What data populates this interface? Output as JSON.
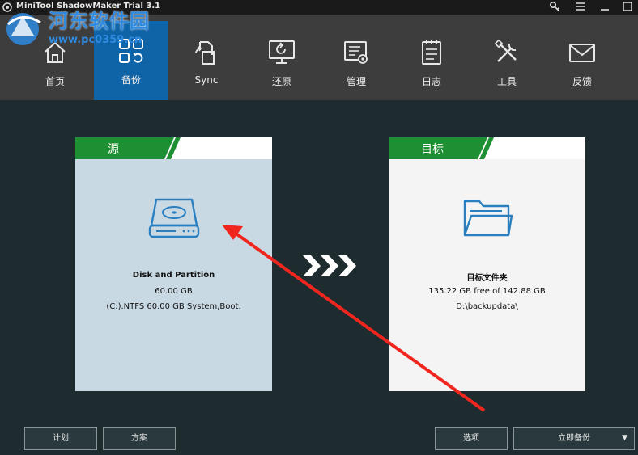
{
  "window": {
    "title": "MiniTool ShadowMaker Trial 3.1",
    "controls": [
      "key-icon",
      "menu-icon",
      "minimize-icon",
      "maximize-icon"
    ]
  },
  "watermark": {
    "main": "河东软件园",
    "url": "www.pc0359.cn"
  },
  "nav": {
    "items": [
      {
        "label": "首页",
        "icon": "home-icon"
      },
      {
        "label": "备份",
        "icon": "backup-icon",
        "active": true
      },
      {
        "label": "Sync",
        "icon": "sync-icon"
      },
      {
        "label": "还原",
        "icon": "restore-icon"
      },
      {
        "label": "管理",
        "icon": "manage-icon"
      },
      {
        "label": "日志",
        "icon": "log-icon"
      },
      {
        "label": "工具",
        "icon": "tools-icon"
      },
      {
        "label": "反馈",
        "icon": "feedback-icon"
      }
    ]
  },
  "source": {
    "tab_label": "源",
    "title": "Disk and Partition",
    "size": "60.00 GB",
    "detail": "(C:).NTFS 60.00 GB System,Boot."
  },
  "target": {
    "tab_label": "目标",
    "title": "目标文件夹",
    "free": "135.22 GB free of 142.88 GB",
    "path": "D:\\backupdata\\"
  },
  "buttons": {
    "schedule": "计划",
    "scheme": "方案",
    "options": "选项",
    "backup_now": "立即备份"
  },
  "colors": {
    "active_nav": "#0f64a8",
    "tab_green": "#1e8f33",
    "annotation_red": "#f0261e"
  }
}
